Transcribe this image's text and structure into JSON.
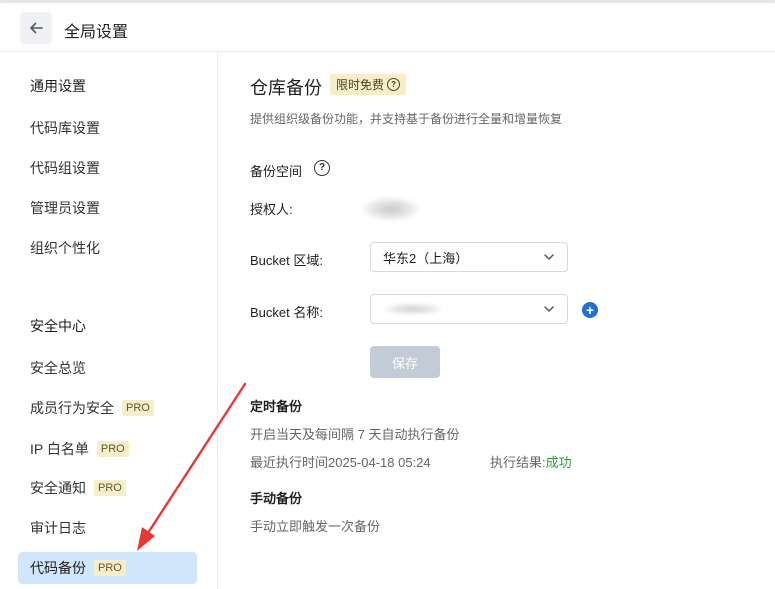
{
  "header": {
    "title": "全局设置",
    "back_icon": "arrow-left-icon"
  },
  "sidebar": {
    "general_heading": "通用设置",
    "general_items": [
      {
        "label": "代码库设置"
      },
      {
        "label": "代码组设置"
      },
      {
        "label": "管理员设置"
      },
      {
        "label": "组织个性化"
      }
    ],
    "security_heading": "安全中心",
    "security_items": [
      {
        "label": "安全总览"
      },
      {
        "label": "成员行为安全",
        "badge": "PRO"
      },
      {
        "label": "IP 白名单",
        "badge": "PRO"
      },
      {
        "label": "安全通知",
        "badge": "PRO"
      },
      {
        "label": "审计日志"
      },
      {
        "label": "代码备份",
        "badge": "PRO",
        "active": true
      }
    ]
  },
  "main": {
    "title": "仓库备份",
    "free_badge": "限时免费",
    "description": "提供组织级备份功能，并支持基于备份进行全量和增量恢复",
    "backup_space": {
      "label": "备份空间",
      "authorizer_label": "授权人:",
      "bucket_region_label": "Bucket 区域:",
      "bucket_region_value": "华东2（上海）",
      "bucket_name_label": "Bucket 名称:",
      "save_label": "保存"
    },
    "scheduled": {
      "title": "定时备份",
      "description": "开启当天及每间隔 7 天自动执行备份",
      "last_run_label": "最近执行时间2025-04-18 05:24",
      "result_label": "执行结果:",
      "result_value": "成功"
    },
    "manual": {
      "title": "手动备份",
      "description": "手动立即触发一次备份"
    }
  },
  "colors": {
    "accent": "#1f6fd6",
    "active_bg": "#cfe6fb",
    "pro_badge_bg": "#f6eec9",
    "success": "#2e9e3e",
    "annotation_arrow": "#e53935"
  }
}
